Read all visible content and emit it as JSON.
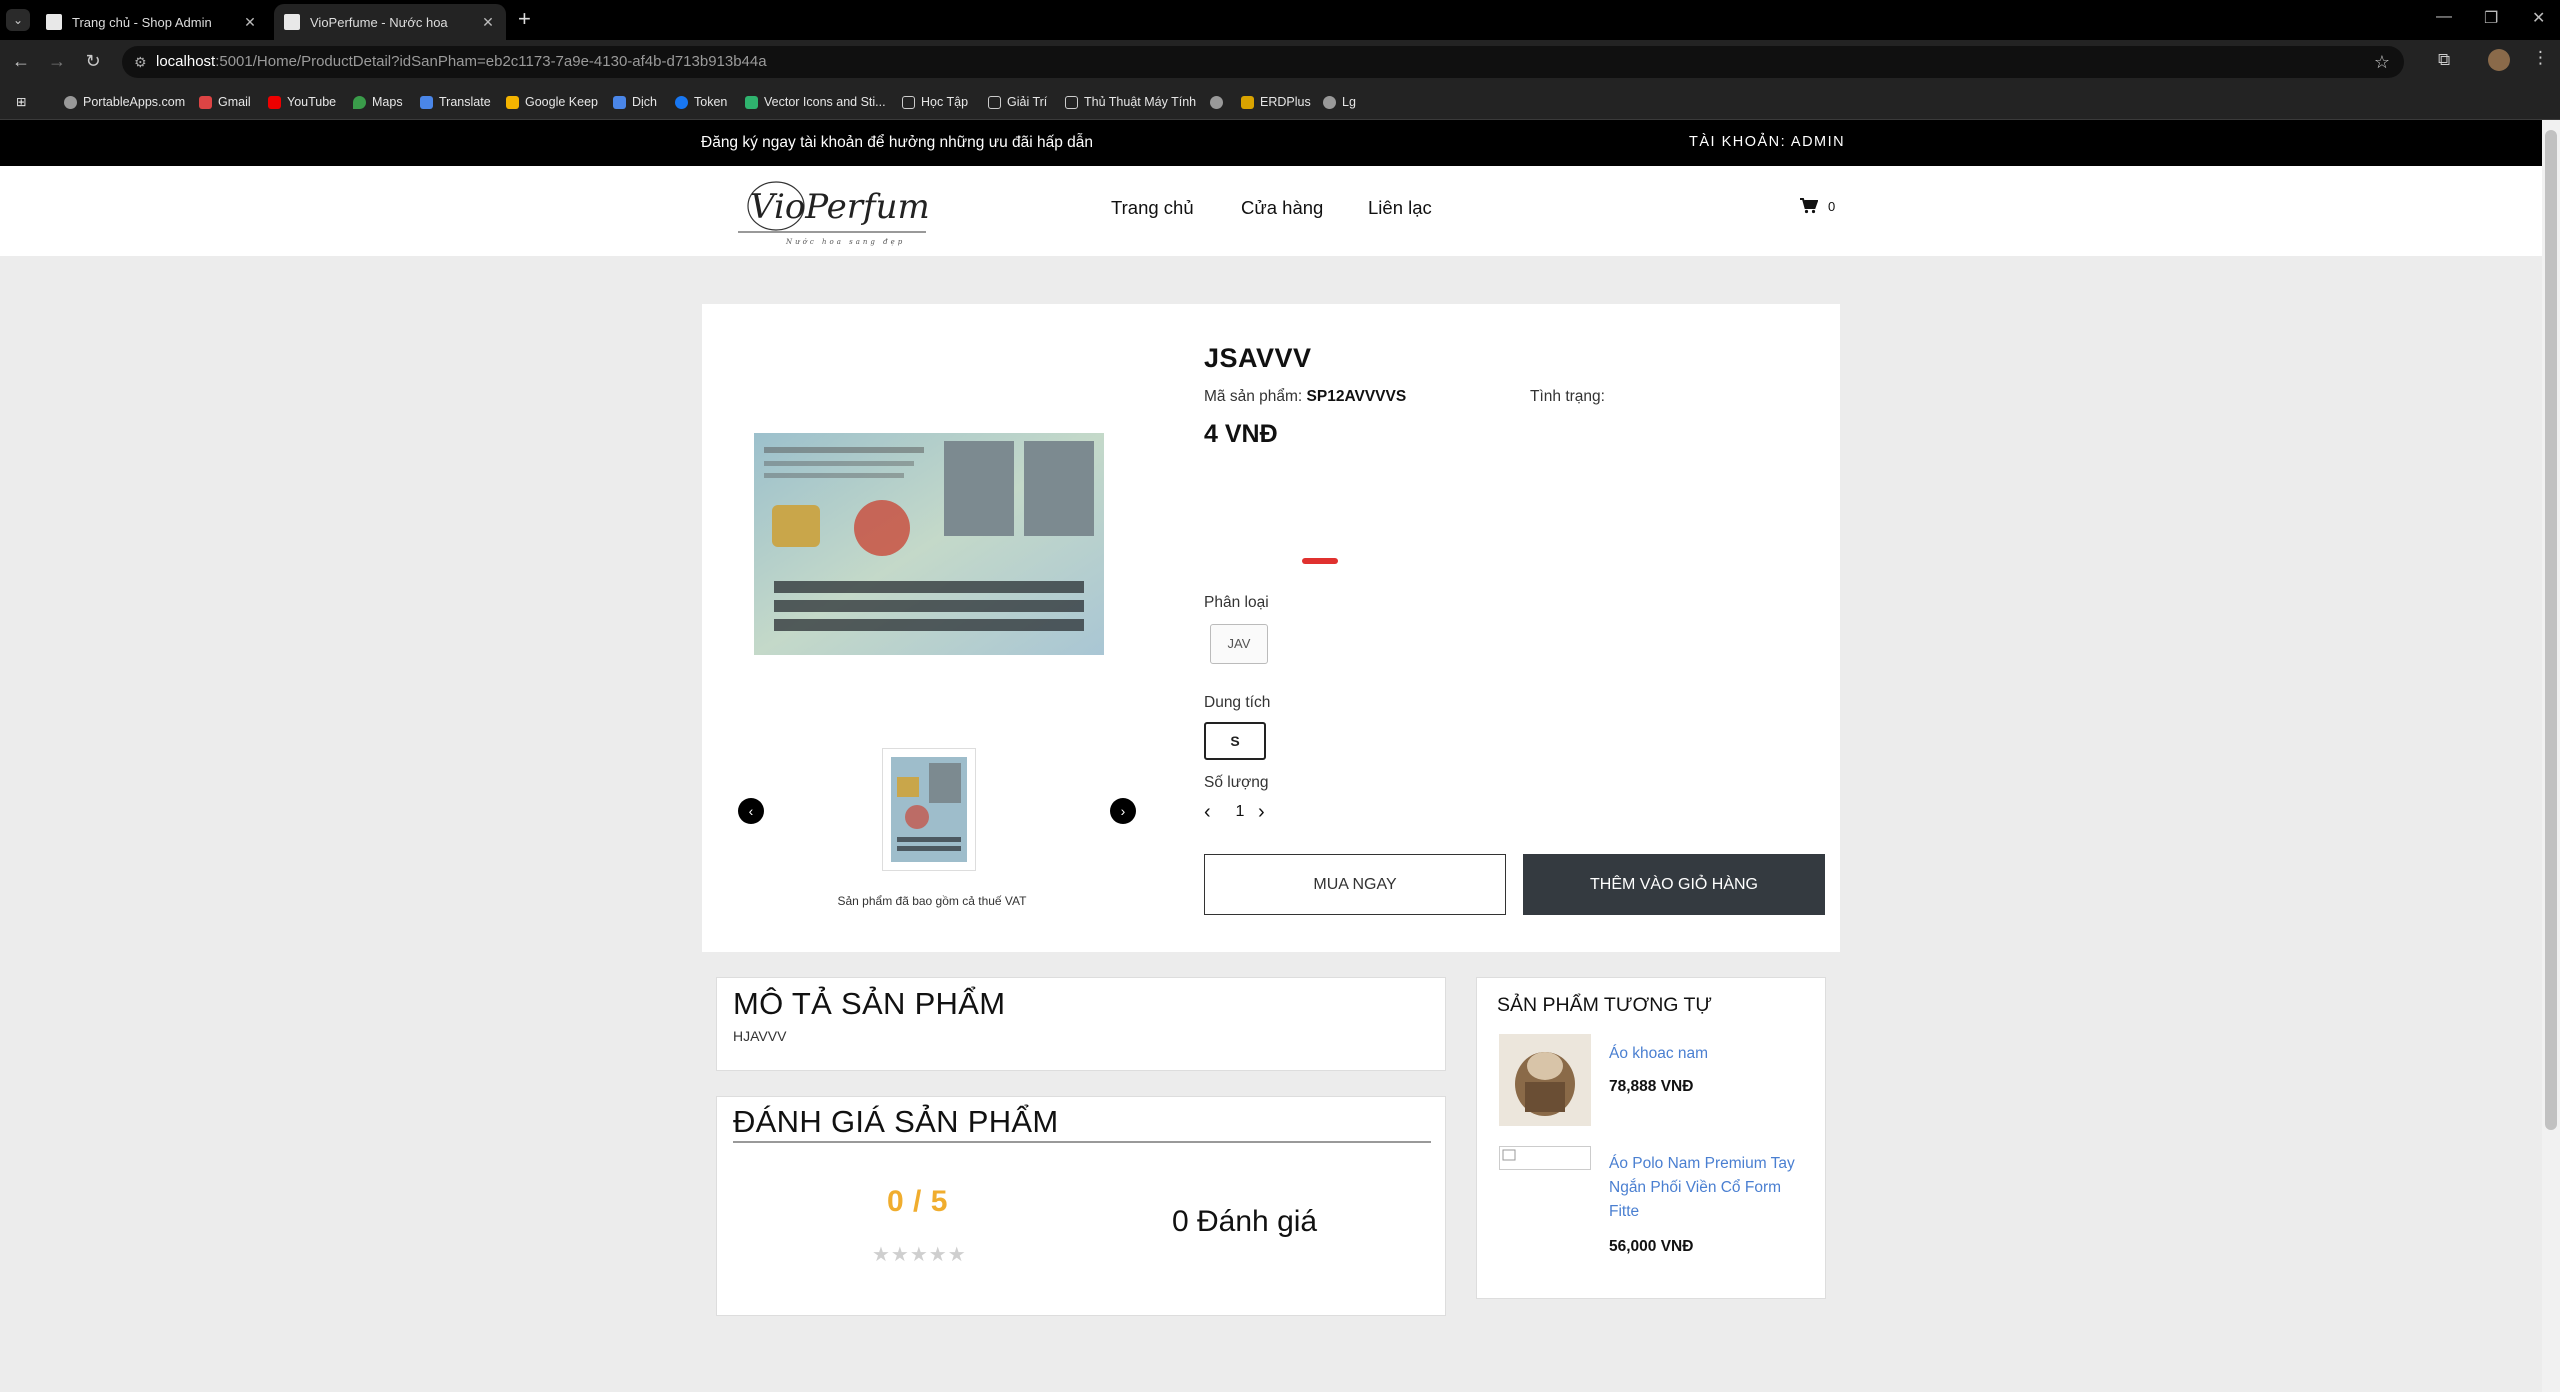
{
  "browser": {
    "tabs": [
      {
        "title": "Trang chủ - Shop Admin",
        "active": false
      },
      {
        "title": "VioPerfume - Nước hoa",
        "active": true
      }
    ],
    "url_host": "localhost",
    "url_path": ":5001/Home/ProductDetail?idSanPham=eb2c1173-7a9e-4130-af4b-d713b913b44a",
    "bookmarks": [
      "PortableApps.com",
      "Gmail",
      "YouTube",
      "Maps",
      "Translate",
      "Google Keep",
      "Dịch",
      "Token",
      "Vector Icons and Sti...",
      "Học Tập",
      "Giải Trí",
      "Thủ Thuật Máy Tính",
      "",
      "ERDPlus",
      "Lg"
    ]
  },
  "site": {
    "promo_text": "Đăng ký ngay tài khoản để hưởng những ưu đãi hấp dẫn",
    "account_text": "TÀI KHOẢN: ADMIN",
    "logo_text": "VioPerfume",
    "logo_tagline": "Nước hoa sang đẹp",
    "nav": [
      "Trang chủ",
      "Cửa hàng",
      "Liên lạc"
    ],
    "cart_count": "0"
  },
  "product": {
    "name": "JSAVVV",
    "sku_label": "Mã sản phẩm:",
    "sku": "SP12AVVVVS",
    "status_label": "Tình trạng:",
    "price": "4 VNĐ",
    "variant_label": "Phân loại",
    "variant_option": "JAV",
    "volume_label": "Dung tích",
    "volume_option": "S",
    "quantity_label": "Số lượng",
    "quantity": "1",
    "buy_now": "MUA NGAY",
    "add_to_cart": "THÊM VÀO GIỎ HÀNG",
    "vat_note": "Sản phẩm đã bao gồm cả thuế VAT"
  },
  "description": {
    "title": "MÔ TẢ SẢN PHẨM",
    "text": "HJAVVV"
  },
  "reviews": {
    "title": "ĐÁNH GIÁ SẢN PHẨM",
    "score": "0 / 5",
    "stars": "★★★★★",
    "count": "0 Đánh giá"
  },
  "similar": {
    "title": "SẢN PHẨM TƯƠNG TỰ",
    "items": [
      {
        "name": "Áo khoac nam",
        "price": "78,888 VNĐ"
      },
      {
        "name": "Áo Polo Nam Premium Tay Ngắn Phối Viền Cổ Form Fitte",
        "price": "56,000 VNĐ"
      }
    ]
  },
  "colors": {
    "price_accent": "#e0312f",
    "score": "#f0ad2e",
    "link": "#4a7fd1",
    "dark_button": "#343a40"
  }
}
